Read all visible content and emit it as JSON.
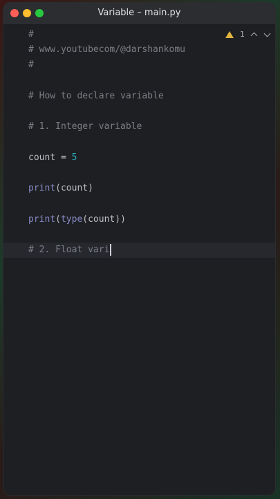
{
  "window": {
    "title": "Variable – main.py"
  },
  "inspections": {
    "warning_count": "1",
    "warning_color": "#e2b340"
  },
  "code": {
    "line1": "#",
    "line2": "# www.youtubecom/@darshankomu",
    "line3": "#",
    "line5": "# How to declare variable",
    "line7": "# 1. Integer variable",
    "line9_var": "count",
    "line9_op": " = ",
    "line9_num": "5",
    "line11_fn": "print",
    "line11_rest": "(count)",
    "line13_fn": "print",
    "line13_open": "(",
    "line13_fn2": "type",
    "line13_rest": "(count))",
    "line15": "# 2. Float vari"
  },
  "colors": {
    "background": "#1e1f22",
    "comment": "#7a7e85",
    "number": "#2aacb8",
    "builtin": "#8888c6",
    "text": "#bcbec4"
  }
}
